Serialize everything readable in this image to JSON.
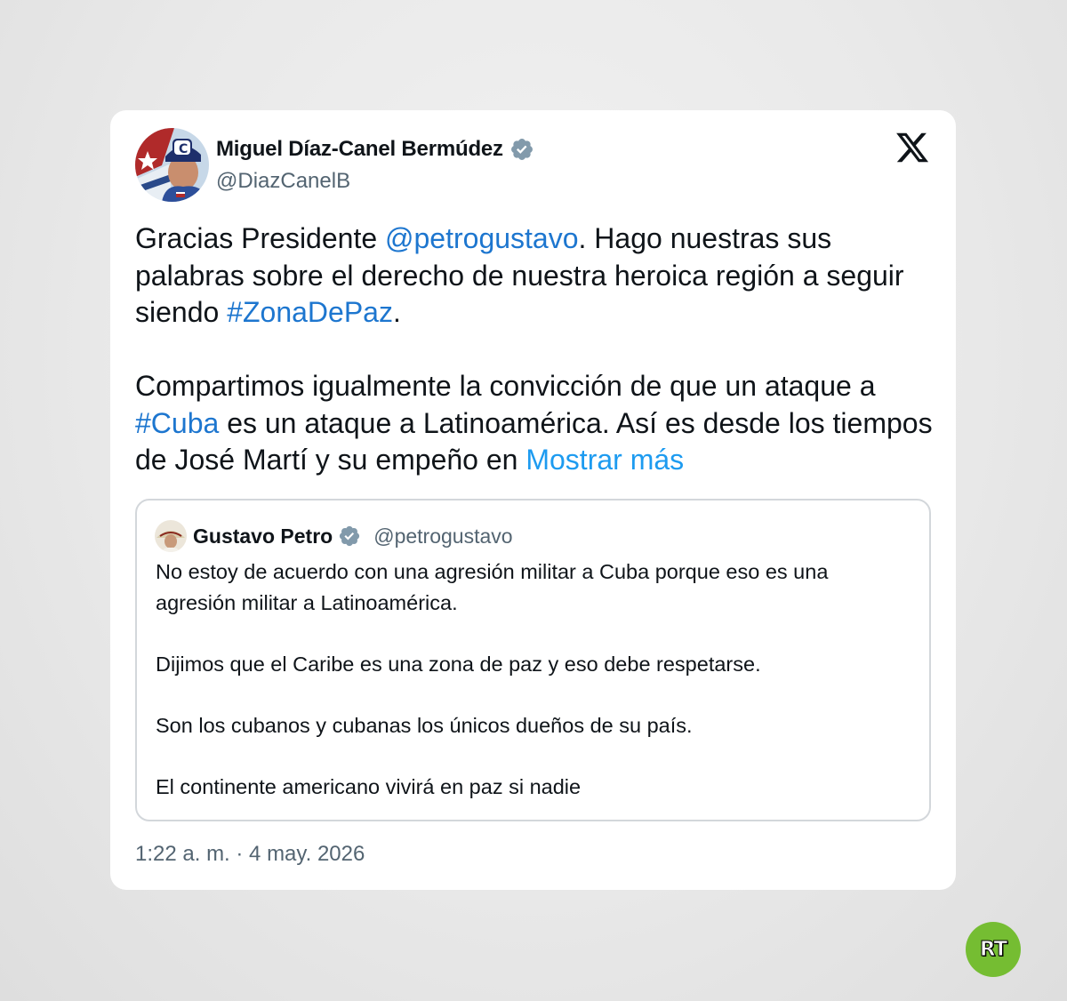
{
  "tweet": {
    "author": {
      "name": "Miguel Díaz-Canel Bermúdez",
      "handle": "@DiazCanelB",
      "verified": true,
      "avatar_icon": "profile-photo"
    },
    "platform_icon": "x-logo-icon",
    "paragraphs": [
      [
        {
          "text": "Gracias Presidente ",
          "type": "text"
        },
        {
          "text": "@petrogustavo",
          "type": "mention"
        },
        {
          "text": ". Hago nuestras sus palabras sobre el derecho de nuestra heroica región a seguir siendo ",
          "type": "text"
        },
        {
          "text": "#ZonaDePaz",
          "type": "hashtag"
        },
        {
          "text": ".",
          "type": "text"
        }
      ],
      [
        {
          "text": "Compartimos igualmente la convicción de que un ataque a ",
          "type": "text"
        },
        {
          "text": "#Cuba",
          "type": "hashtag"
        },
        {
          "text": " es un ataque a Latinoamérica. Así es desde los tiempos de José Martí y su empeño en ",
          "type": "text"
        },
        {
          "text": "Mostrar más",
          "type": "show_more"
        }
      ]
    ],
    "quoted_tweet": {
      "author_name": "Gustavo Petro",
      "author_handle": "@petrogustavo",
      "verified": true,
      "paragraphs": [
        "No estoy de acuerdo con una agresión militar a Cuba porque eso es una agresión militar a Latinoamérica.",
        "Dijimos que el Caribe es una zona de paz y eso debe respetarse.",
        "Son los cubanos y cubanas los únicos dueños de su país.",
        "El continente americano vivirá en paz si nadie"
      ]
    },
    "timestamp": "1:22 a. m. · 4 may. 2026"
  },
  "watermark": {
    "label": "RT",
    "color": "#75bd32"
  },
  "colors": {
    "link": "#1d76cf",
    "show_more": "#1d9bf0",
    "verified": "#829aab",
    "secondary_text": "#536471",
    "primary_text": "#0f1419"
  }
}
